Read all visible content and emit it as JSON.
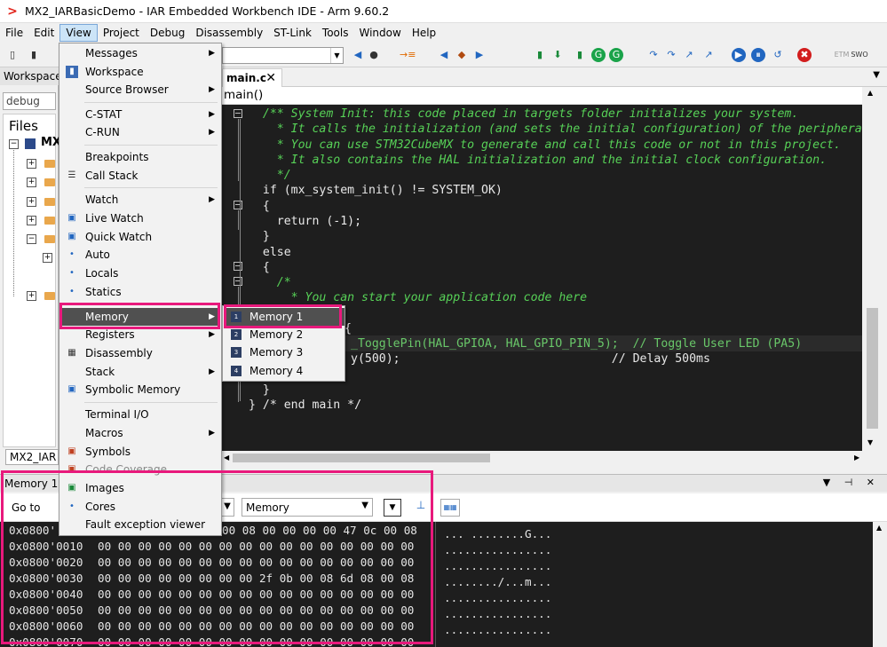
{
  "window": {
    "title": "MX2_IARBasicDemo - IAR Embedded Workbench IDE - Arm 9.60.2",
    "logo": ">"
  },
  "menubar": [
    "File",
    "Edit",
    "View",
    "Project",
    "Debug",
    "Disassembly",
    "ST-Link",
    "Tools",
    "Window",
    "Help"
  ],
  "toolbar": {
    "icons": [
      "◀",
      "●",
      "→≡",
      "◀",
      "◆",
      "▶",
      "▮",
      "⬇",
      "▮",
      "G",
      "G",
      "↷",
      "↷",
      "↗",
      "↗",
      "▶",
      "⏸",
      "↺",
      "✖"
    ],
    "extra_labels": [
      "ETM",
      "SWO"
    ]
  },
  "workspace": {
    "header": "Workspace",
    "config": "debug",
    "files_label": "Files",
    "project_abbrev": "MX",
    "tab": "MX2_IAR"
  },
  "editor": {
    "tab": "main.c",
    "tab_close": "✕",
    "function": "main()",
    "func_icon": "f()"
  },
  "code_lines": [
    "  /** System Init: this code placed in targets folder initializes your system.",
    "    * It calls the initialization (and sets the initial configuration) of the peripherals.",
    "    * You can use STM32CubeMX to generate and call this code or not in this project.",
    "    * It also contains the HAL initialization and the initial clock configuration.",
    "    */",
    "  if (mx_system_init() != SYSTEM_OK)",
    "  {",
    "    return (-1);",
    "  }",
    "  else",
    "  {",
    "    /*",
    "      * You can start your application code here",
    "",
    "{",
    "_TogglePin(HAL_GPIOA, HAL_GPIO_PIN_5);  // Toggle User LED (PA5)",
    "y(500);                              // Delay 500ms",
    "",
    "  }",
    "} /* end main */"
  ],
  "memory_panel": {
    "title": "Memory 1",
    "goto_label": "Go to",
    "zone": "Memory",
    "controls": "▼ ⊣ ✕",
    "rows": [
      {
        "addr": "0x0800'",
        "hex": "00 08 00 00 00 00 47 0c 00 08",
        "ascii": "... ........G..."
      },
      {
        "addr": "0x0800'0010",
        "hex": "00 00 00 00 00 00 00 00 00 00 00 00 00 00 00 00",
        "ascii": "................"
      },
      {
        "addr": "0x0800'0020",
        "hex": "00 00 00 00 00 00 00 00 00 00 00 00 00 00 00 00",
        "ascii": "................"
      },
      {
        "addr": "0x0800'0030",
        "hex": "00 00 00 00 00 00 00 00 2f 0b 00 08 6d 08 00 08",
        "ascii": "......../...m..."
      },
      {
        "addr": "0x0800'0040",
        "hex": "00 00 00 00 00 00 00 00 00 00 00 00 00 00 00 00",
        "ascii": "................"
      },
      {
        "addr": "0x0800'0050",
        "hex": "00 00 00 00 00 00 00 00 00 00 00 00 00 00 00 00",
        "ascii": "................"
      },
      {
        "addr": "0x0800'0060",
        "hex": "00 00 00 00 00 00 00 00 00 00 00 00 00 00 00 00",
        "ascii": "................"
      },
      {
        "addr": "0x0800'0070",
        "hex": "00 00 00 00 00 00 00 00 00 00 00 00 00 00 00 00",
        "ascii": "................"
      }
    ]
  },
  "view_menu": {
    "items": [
      {
        "label": "Messages",
        "icon": "",
        "submenu": true
      },
      {
        "label": "Workspace",
        "icon": "▮",
        "submenu": false
      },
      {
        "label": "Source Browser",
        "icon": "",
        "submenu": true
      },
      {
        "label": "C-STAT",
        "icon": "",
        "submenu": true
      },
      {
        "label": "C-RUN",
        "icon": "",
        "submenu": true
      },
      {
        "label": "Breakpoints",
        "icon": "",
        "submenu": false
      },
      {
        "label": "Call Stack",
        "icon": "☰",
        "submenu": false
      },
      {
        "label": "Watch",
        "icon": "",
        "submenu": true
      },
      {
        "label": "Live Watch",
        "icon": "▣",
        "submenu": false
      },
      {
        "label": "Quick Watch",
        "icon": "▣",
        "submenu": false
      },
      {
        "label": "Auto",
        "icon": "•",
        "submenu": false
      },
      {
        "label": "Locals",
        "icon": "•",
        "submenu": false
      },
      {
        "label": "Statics",
        "icon": "•",
        "submenu": false
      },
      {
        "label": "Memory",
        "icon": "",
        "submenu": true
      },
      {
        "label": "Registers",
        "icon": "",
        "submenu": true
      },
      {
        "label": "Disassembly",
        "icon": "▦",
        "submenu": false
      },
      {
        "label": "Stack",
        "icon": "",
        "submenu": true
      },
      {
        "label": "Symbolic Memory",
        "icon": "▣",
        "submenu": false
      },
      {
        "label": "Terminal I/O",
        "icon": "",
        "submenu": false
      },
      {
        "label": "Macros",
        "icon": "",
        "submenu": true
      },
      {
        "label": "Symbols",
        "icon": "▣",
        "submenu": false
      },
      {
        "label": "Code Coverage",
        "icon": "▣",
        "submenu": false
      },
      {
        "label": "Images",
        "icon": "▣",
        "submenu": false
      },
      {
        "label": "Cores",
        "icon": "•",
        "submenu": false
      },
      {
        "label": "Fault exception viewer",
        "icon": "",
        "submenu": false
      }
    ],
    "submenu_arrow": "▶"
  },
  "memory_submenu": {
    "items": [
      "Memory 1",
      "Memory 2",
      "Memory 3",
      "Memory 4"
    ],
    "icon_labels": [
      "1",
      "2",
      "3",
      "4"
    ]
  },
  "colors": {
    "highlight": "#e8197c",
    "comment": "#57d157",
    "function": "#6db1f1"
  }
}
